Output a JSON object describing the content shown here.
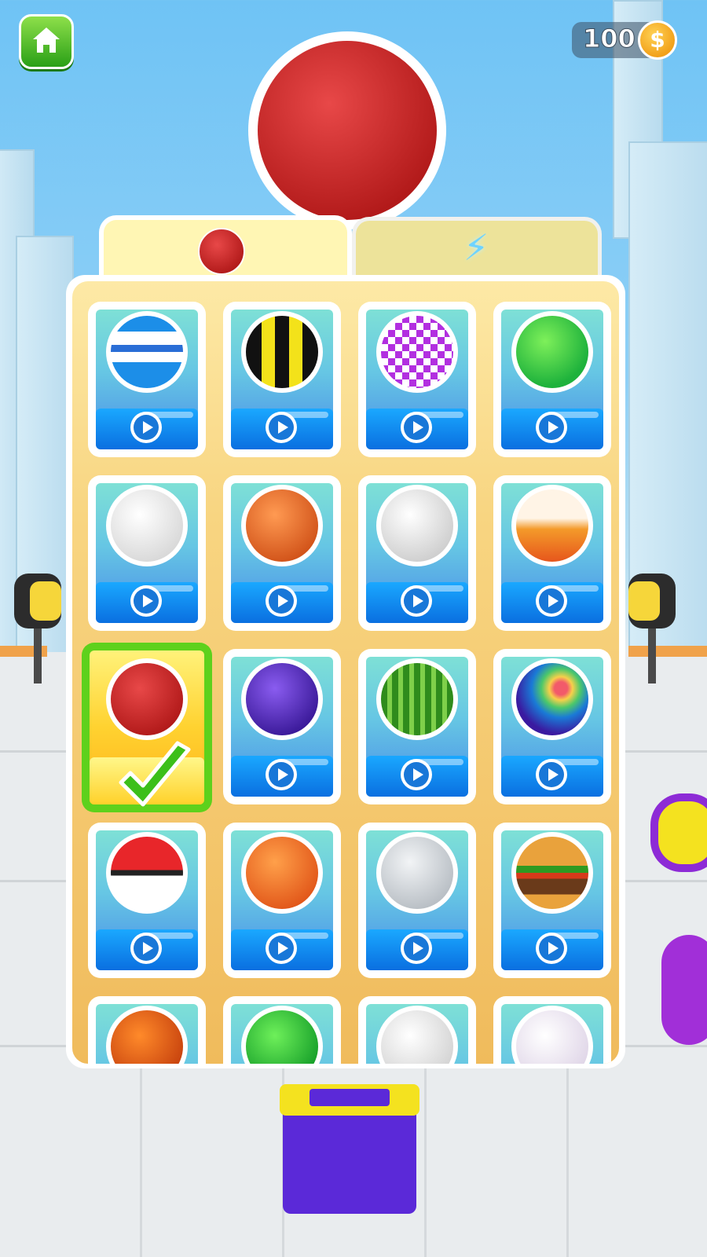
{
  "header": {
    "coins": "100",
    "coin_symbol": "$"
  },
  "preview": {
    "ball": "strawberry"
  },
  "tabs": [
    {
      "id": "balls",
      "icon": "strawberry-ball-icon",
      "active": true
    },
    {
      "id": "power",
      "icon": "lightning-icon",
      "active": false
    }
  ],
  "colors": {
    "accent_green": "#5ed11c",
    "button_blue": "#0a6fe0",
    "panel": "#f8d581"
  },
  "grid": {
    "selected": "strawberry",
    "items": [
      {
        "name": "blue-stripe",
        "state": "watch"
      },
      {
        "name": "bumblebee",
        "state": "watch"
      },
      {
        "name": "purple-checker",
        "state": "watch"
      },
      {
        "name": "green-star",
        "state": "watch"
      },
      {
        "name": "baseball",
        "state": "watch"
      },
      {
        "name": "basketball",
        "state": "watch"
      },
      {
        "name": "soccer",
        "state": "watch"
      },
      {
        "name": "flame",
        "state": "watch"
      },
      {
        "name": "strawberry",
        "state": "selected"
      },
      {
        "name": "blackberry",
        "state": "watch"
      },
      {
        "name": "watermelon",
        "state": "watch"
      },
      {
        "name": "rainbow",
        "state": "watch"
      },
      {
        "name": "pokeball",
        "state": "watch"
      },
      {
        "name": "dragon-star",
        "state": "watch"
      },
      {
        "name": "moon",
        "state": "watch"
      },
      {
        "name": "burger",
        "state": "watch"
      },
      {
        "name": "pumpkin",
        "state": "watch"
      },
      {
        "name": "green-skull",
        "state": "watch"
      },
      {
        "name": "skull",
        "state": "watch"
      },
      {
        "name": "candy-skull",
        "state": "watch"
      }
    ]
  }
}
